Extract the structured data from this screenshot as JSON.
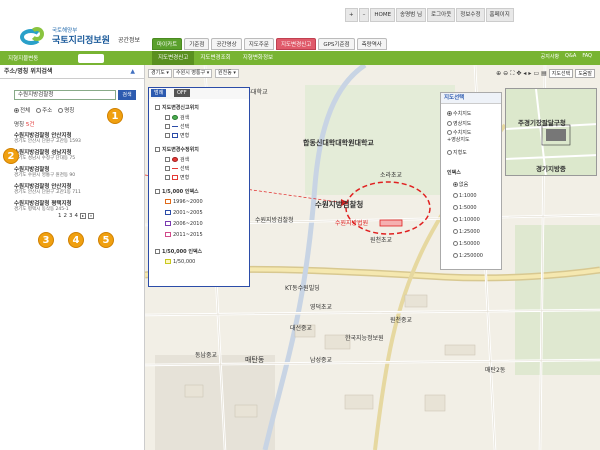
{
  "util": {
    "links": [
      "+",
      "–",
      "HOME",
      "송명범 님",
      "로그아웃",
      "정보수정",
      "홈페이지"
    ]
  },
  "brand": {
    "ministry": "국토해양부",
    "name": "국토지리정보원",
    "sub": "공간정보"
  },
  "tabs": [
    "마이카트",
    "기준점",
    "공간영상",
    "지도주문",
    "지도변경신고",
    "GPS기준점",
    "측량역사"
  ],
  "nav": {
    "left": "지형지물변동",
    "map_btn": "지도보기",
    "sub": [
      "지도변경신고",
      "지도변경조회",
      "지형변화정보"
    ],
    "right": [
      "공지사항",
      "Q&A",
      "FAQ"
    ]
  },
  "left_panel": {
    "title": "주소/명칭 위치검색",
    "search_value": "수원지방검찰청",
    "search_btn": "검색",
    "radios": [
      "전체",
      "주소",
      "명칭"
    ],
    "count_prefix": "명칭",
    "count": "5건",
    "results": [
      {
        "title": "수원지방검찰청 안산지청",
        "addr": "경기도 안산시 단원구 고잔동 1593"
      },
      {
        "title": "수원지방검찰청 성남지청",
        "addr": "경기도 성남시 수정구 단대동 75"
      },
      {
        "title": "수원지방검찰청",
        "addr": "경기도 수원시 영통구 원천동 90"
      },
      {
        "title": "수원지방검찰청 안산지청",
        "addr": "경기도 안산시 단원구 고잔1동 711"
      },
      {
        "title": "수원지방검찰청 평택지청",
        "addr": "경기도 평택시 동삭동 245-1"
      }
    ],
    "pager": [
      "1",
      "2",
      "3",
      "4"
    ]
  },
  "badges": [
    "1",
    "2",
    "3",
    "4",
    "5"
  ],
  "map_toolbar": {
    "dd1": "경기도 ▾",
    "dd2": "수원시 영통구 ▾",
    "dd3": "원천동 ▾",
    "btn1": "지도선택",
    "btn2": "도움말"
  },
  "legend": {
    "label": "범례",
    "off": "OFF",
    "groups": [
      {
        "title": "지도변경신고위치",
        "items": [
          "검색",
          "선택",
          "면형"
        ]
      },
      {
        "title": "지도변경수정위치",
        "items": [
          "검색",
          "선택",
          "면형"
        ]
      },
      {
        "title": "1/5,000 인덱스",
        "items": [
          "1996~2000",
          "2001~2005",
          "2006~2010",
          "2011~2015"
        ]
      },
      {
        "title": "1/50,000 인덱스",
        "items": [
          "1/50,000"
        ]
      }
    ]
  },
  "sel_panel": {
    "title": "지도선택",
    "map_opts": [
      "수치지도",
      "영상지도",
      "수치지도\n+영상지도",
      "지형도"
    ],
    "index_title": "인덱스",
    "scales": [
      "없음",
      "1:1000",
      "1:5000",
      "1:10000",
      "1:25000",
      "1:50000",
      "1:250000"
    ]
  },
  "map_labels": {
    "univ": "합동신대학대학원대학교",
    "target": "수원지방검찰청",
    "court": "수원지방법원",
    "ov1": "주경기장팔달구청",
    "ov2": "경기지방중",
    "misc": [
      "수원지방검찰청",
      "원천초교",
      "영덕초교",
      "동남중교",
      "대선중교",
      "남성중교",
      "매탄동",
      "원천중교",
      "아주대학교",
      "소라초교",
      "KT동수원빌딩",
      "한국지능정보원",
      "매탄2동"
    ]
  },
  "colors": {
    "green": "#78b432",
    "blue": "#2b4ca8",
    "red": "#e02020",
    "orange": "#f0a010"
  }
}
